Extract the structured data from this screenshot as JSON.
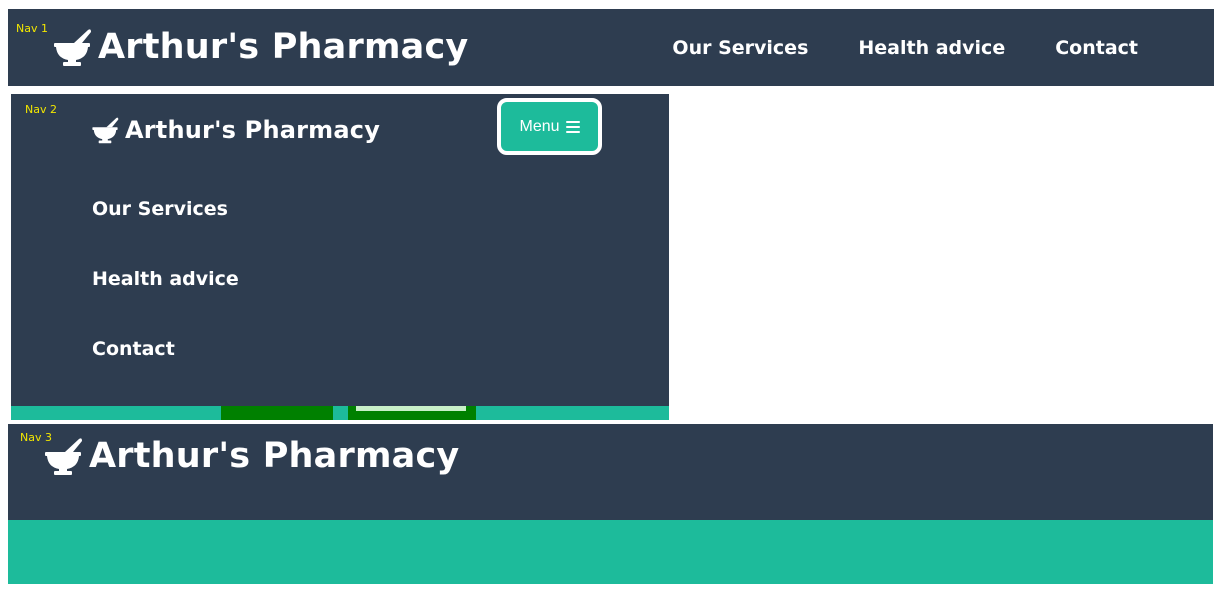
{
  "brand": {
    "name": "Arthur's Pharmacy",
    "icon": "mortar-pestle-icon"
  },
  "colors": {
    "nav_bg": "#2e3d50",
    "accent": "#1dbb9b",
    "tag_yellow": "#f2e600",
    "green": "#008000"
  },
  "nav1": {
    "tag": "Nav 1",
    "links": [
      "Our Services",
      "Health advice",
      "Contact"
    ]
  },
  "nav2": {
    "tag": "Nav 2",
    "menu_label": "Menu",
    "menu_icon": "hamburger-icon",
    "links": [
      "Our Services",
      "Health advice",
      "Contact"
    ]
  },
  "nav3": {
    "tag": "Nav 3"
  }
}
